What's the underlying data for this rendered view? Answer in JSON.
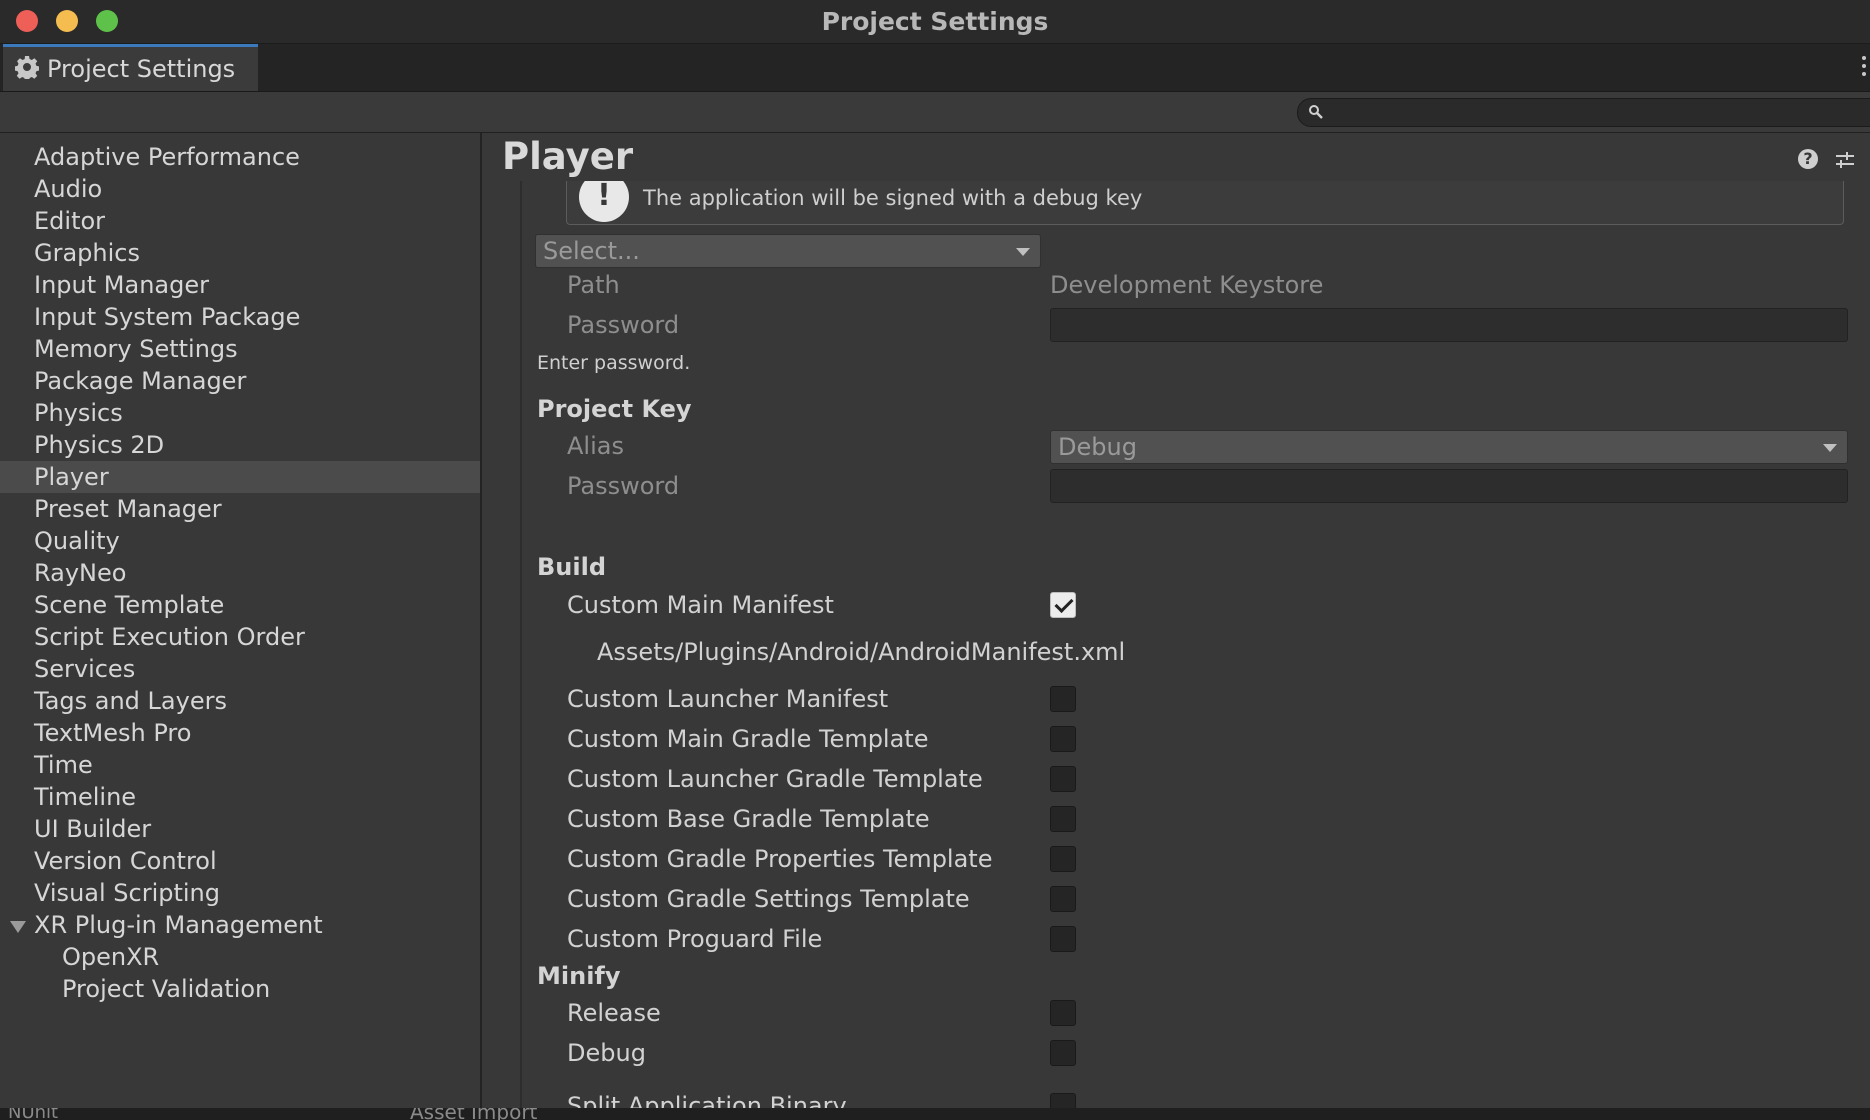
{
  "window": {
    "title": "Project Settings"
  },
  "tab": {
    "label": "Project Settings"
  },
  "search": {
    "placeholder": ""
  },
  "sidebar": {
    "items": [
      {
        "label": "Adaptive Performance"
      },
      {
        "label": "Audio"
      },
      {
        "label": "Editor"
      },
      {
        "label": "Graphics"
      },
      {
        "label": "Input Manager"
      },
      {
        "label": "Input System Package"
      },
      {
        "label": "Memory Settings"
      },
      {
        "label": "Package Manager"
      },
      {
        "label": "Physics"
      },
      {
        "label": "Physics 2D"
      },
      {
        "label": "Player",
        "selected": true
      },
      {
        "label": "Preset Manager"
      },
      {
        "label": "Quality"
      },
      {
        "label": "RayNeo"
      },
      {
        "label": "Scene Template"
      },
      {
        "label": "Script Execution Order"
      },
      {
        "label": "Services"
      },
      {
        "label": "Tags and Layers"
      },
      {
        "label": "TextMesh Pro"
      },
      {
        "label": "Time"
      },
      {
        "label": "Timeline"
      },
      {
        "label": "UI Builder"
      },
      {
        "label": "Version Control"
      },
      {
        "label": "Visual Scripting"
      },
      {
        "label": "XR Plug-in Management",
        "expanded": true
      },
      {
        "label": "OpenXR",
        "child": true
      },
      {
        "label": "Project Validation",
        "child": true
      }
    ]
  },
  "main": {
    "title": "Player",
    "help_message": "The application will be signed with a debug key",
    "keystore": {
      "select_value": "Select...",
      "path_label": "Path",
      "path_value": "Development Keystore",
      "password_label": "Password",
      "password_value": "",
      "hint": "Enter password."
    },
    "project_key": {
      "heading": "Project Key",
      "alias_label": "Alias",
      "alias_value": "Debug",
      "password_label": "Password",
      "password_value": ""
    },
    "build": {
      "heading": "Build",
      "items": [
        {
          "label": "Custom Main Manifest",
          "checked": true
        },
        {
          "label": "Custom Launcher Manifest",
          "checked": false
        },
        {
          "label": "Custom Main Gradle Template",
          "checked": false
        },
        {
          "label": "Custom Launcher Gradle Template",
          "checked": false
        },
        {
          "label": "Custom Base Gradle Template",
          "checked": false
        },
        {
          "label": "Custom Gradle Properties Template",
          "checked": false
        },
        {
          "label": "Custom Gradle Settings Template",
          "checked": false
        },
        {
          "label": "Custom Proguard File",
          "checked": false
        }
      ],
      "manifest_path": "Assets/Plugins/Android/AndroidManifest.xml"
    },
    "minify": {
      "heading": "Minify",
      "items": [
        {
          "label": "Release",
          "checked": false
        },
        {
          "label": "Debug",
          "checked": false
        }
      ]
    },
    "split_binary": {
      "label": "Split Application Binary",
      "checked": false
    }
  },
  "statusbar": {
    "left_text": "NUnit",
    "mid_text": "Asset Import"
  }
}
